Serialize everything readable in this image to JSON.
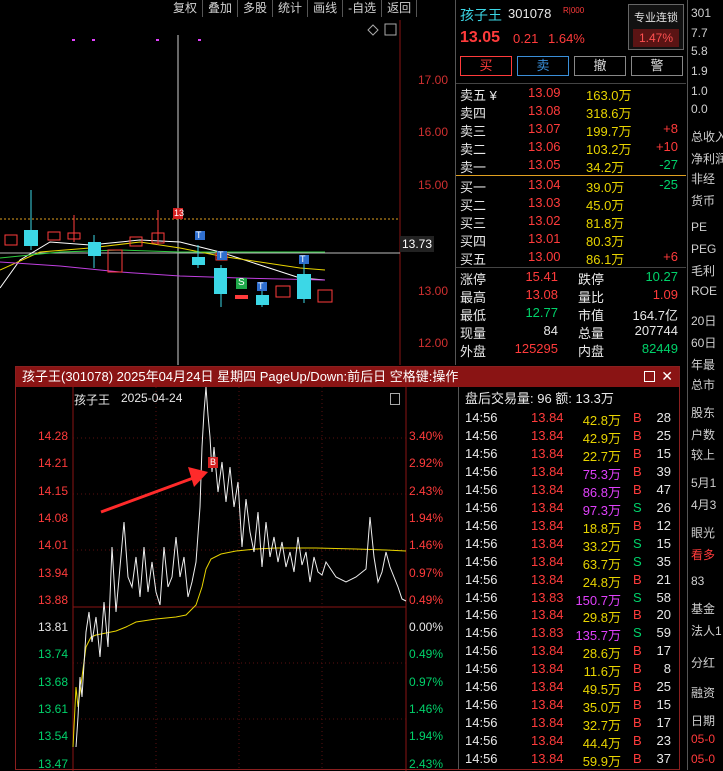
{
  "toolbar": [
    "复权",
    "叠加",
    "多股",
    "统计",
    "画线",
    "-自选",
    "返回"
  ],
  "kline": {
    "price_ticks": [
      "17.00",
      "16.00",
      "15.00",
      "13.00",
      "12.00"
    ],
    "current_price": "13.73",
    "markers": [
      "13",
      "T",
      "T",
      "T",
      "S",
      "T"
    ]
  },
  "quote": {
    "name": "孩子王",
    "code": "301078",
    "badge": "R|000",
    "pro_btn": "专业连锁",
    "pro_pct": "1.47%",
    "price": "13.05",
    "change": "0.21",
    "change_pct": "1.64%",
    "buttons": [
      "买",
      "卖",
      "撤",
      "警"
    ],
    "sell": [
      {
        "label": "卖五 ¥",
        "price": "13.09",
        "vol": "163.0万",
        "delta": ""
      },
      {
        "label": "卖四",
        "price": "13.08",
        "vol": "318.6万",
        "delta": ""
      },
      {
        "label": "卖三",
        "price": "13.07",
        "vol": "199.7万",
        "delta": "+8"
      },
      {
        "label": "卖二",
        "price": "13.06",
        "vol": "103.2万",
        "delta": "+10"
      },
      {
        "label": "卖一",
        "price": "13.05",
        "vol": "34.2万",
        "delta": "-27"
      }
    ],
    "buy": [
      {
        "label": "买一",
        "price": "13.04",
        "vol": "39.0万",
        "delta": "-25"
      },
      {
        "label": "买二",
        "price": "13.03",
        "vol": "45.0万",
        "delta": ""
      },
      {
        "label": "买三",
        "price": "13.02",
        "vol": "81.8万",
        "delta": ""
      },
      {
        "label": "买四",
        "price": "13.01",
        "vol": "80.3万",
        "delta": ""
      },
      {
        "label": "买五",
        "price": "13.00",
        "vol": "86.1万",
        "delta": "+6"
      }
    ],
    "stats": [
      {
        "l1": "涨停",
        "v1": "15.41",
        "l2": "跌停",
        "v2": "10.27"
      },
      {
        "l1": "最高",
        "v1": "13.08",
        "l2": "量比",
        "v2": "1.09"
      },
      {
        "l1": "最低",
        "v1": "12.77",
        "l2": "市值",
        "v2": "164.7亿"
      },
      {
        "l1": "现量",
        "v1": "84",
        "l2": "总量",
        "v2": "207744"
      },
      {
        "l1": "外盘",
        "v1": "125295",
        "l2": "内盘",
        "v2": "82449"
      }
    ]
  },
  "farright": [
    "301",
    "7.7",
    "5.8",
    "1.9",
    "1.0",
    "0.0",
    "总收入",
    "净利润",
    "非经",
    "货币",
    "PE",
    "PEG",
    "毛利",
    "ROE",
    "20日",
    "60日",
    "年最",
    "总市",
    "股东",
    "户数",
    "较上",
    "5月1",
    "4月3",
    "眼光",
    "看多",
    "83",
    "基金",
    "法人1",
    "分红",
    "融资",
    "日期",
    "05-0",
    "05-0"
  ],
  "popup": {
    "title": "孩子王(301078) 2025年04月24日 星期四 PageUp/Down:前后日 空格键:操作",
    "chart_name": "孩子王",
    "chart_date": "2025-04-24",
    "buy_marker": "B",
    "price_ticks": [
      "14.28",
      "14.21",
      "14.15",
      "14.08",
      "14.01",
      "13.94",
      "13.88",
      "13.81",
      "13.74",
      "13.68",
      "13.61",
      "13.54",
      "13.47"
    ],
    "pct_ticks": [
      "3.40%",
      "2.92%",
      "2.43%",
      "1.94%",
      "1.46%",
      "0.97%",
      "0.49%",
      "0.00%",
      "0.49%",
      "0.97%",
      "1.46%",
      "1.94%",
      "2.43%"
    ],
    "trades_header": "盘后交易量: 96  额: 13.3万",
    "trades": [
      {
        "t": "14:56",
        "p": "13.84",
        "a": "42.8万",
        "s": "B",
        "n": "28"
      },
      {
        "t": "14:56",
        "p": "13.84",
        "a": "42.9万",
        "s": "B",
        "n": "25"
      },
      {
        "t": "14:56",
        "p": "13.84",
        "a": "22.7万",
        "s": "B",
        "n": "15"
      },
      {
        "t": "14:56",
        "p": "13.84",
        "a": "75.3万",
        "s": "B",
        "n": "39"
      },
      {
        "t": "14:56",
        "p": "13.84",
        "a": "86.8万",
        "s": "B",
        "n": "47"
      },
      {
        "t": "14:56",
        "p": "13.84",
        "a": "97.3万",
        "s": "S",
        "n": "26"
      },
      {
        "t": "14:56",
        "p": "13.84",
        "a": "18.8万",
        "s": "B",
        "n": "12"
      },
      {
        "t": "14:56",
        "p": "13.84",
        "a": "33.2万",
        "s": "S",
        "n": "15"
      },
      {
        "t": "14:56",
        "p": "13.84",
        "a": "63.7万",
        "s": "S",
        "n": "35"
      },
      {
        "t": "14:56",
        "p": "13.84",
        "a": "24.8万",
        "s": "B",
        "n": "21"
      },
      {
        "t": "14:56",
        "p": "13.83",
        "a": "150.7万",
        "s": "S",
        "n": "58"
      },
      {
        "t": "14:56",
        "p": "13.84",
        "a": "29.8万",
        "s": "B",
        "n": "20"
      },
      {
        "t": "14:56",
        "p": "13.83",
        "a": "135.7万",
        "s": "S",
        "n": "59"
      },
      {
        "t": "14:56",
        "p": "13.84",
        "a": "28.6万",
        "s": "B",
        "n": "17"
      },
      {
        "t": "14:56",
        "p": "13.84",
        "a": "11.6万",
        "s": "B",
        "n": "8"
      },
      {
        "t": "14:56",
        "p": "13.84",
        "a": "49.5万",
        "s": "B",
        "n": "25"
      },
      {
        "t": "14:56",
        "p": "13.84",
        "a": "35.0万",
        "s": "B",
        "n": "15"
      },
      {
        "t": "14:56",
        "p": "13.84",
        "a": "32.7万",
        "s": "B",
        "n": "17"
      },
      {
        "t": "14:56",
        "p": "13.84",
        "a": "44.4万",
        "s": "B",
        "n": "23"
      },
      {
        "t": "14:56",
        "p": "13.84",
        "a": "59.9万",
        "s": "B",
        "n": "37"
      }
    ]
  }
}
